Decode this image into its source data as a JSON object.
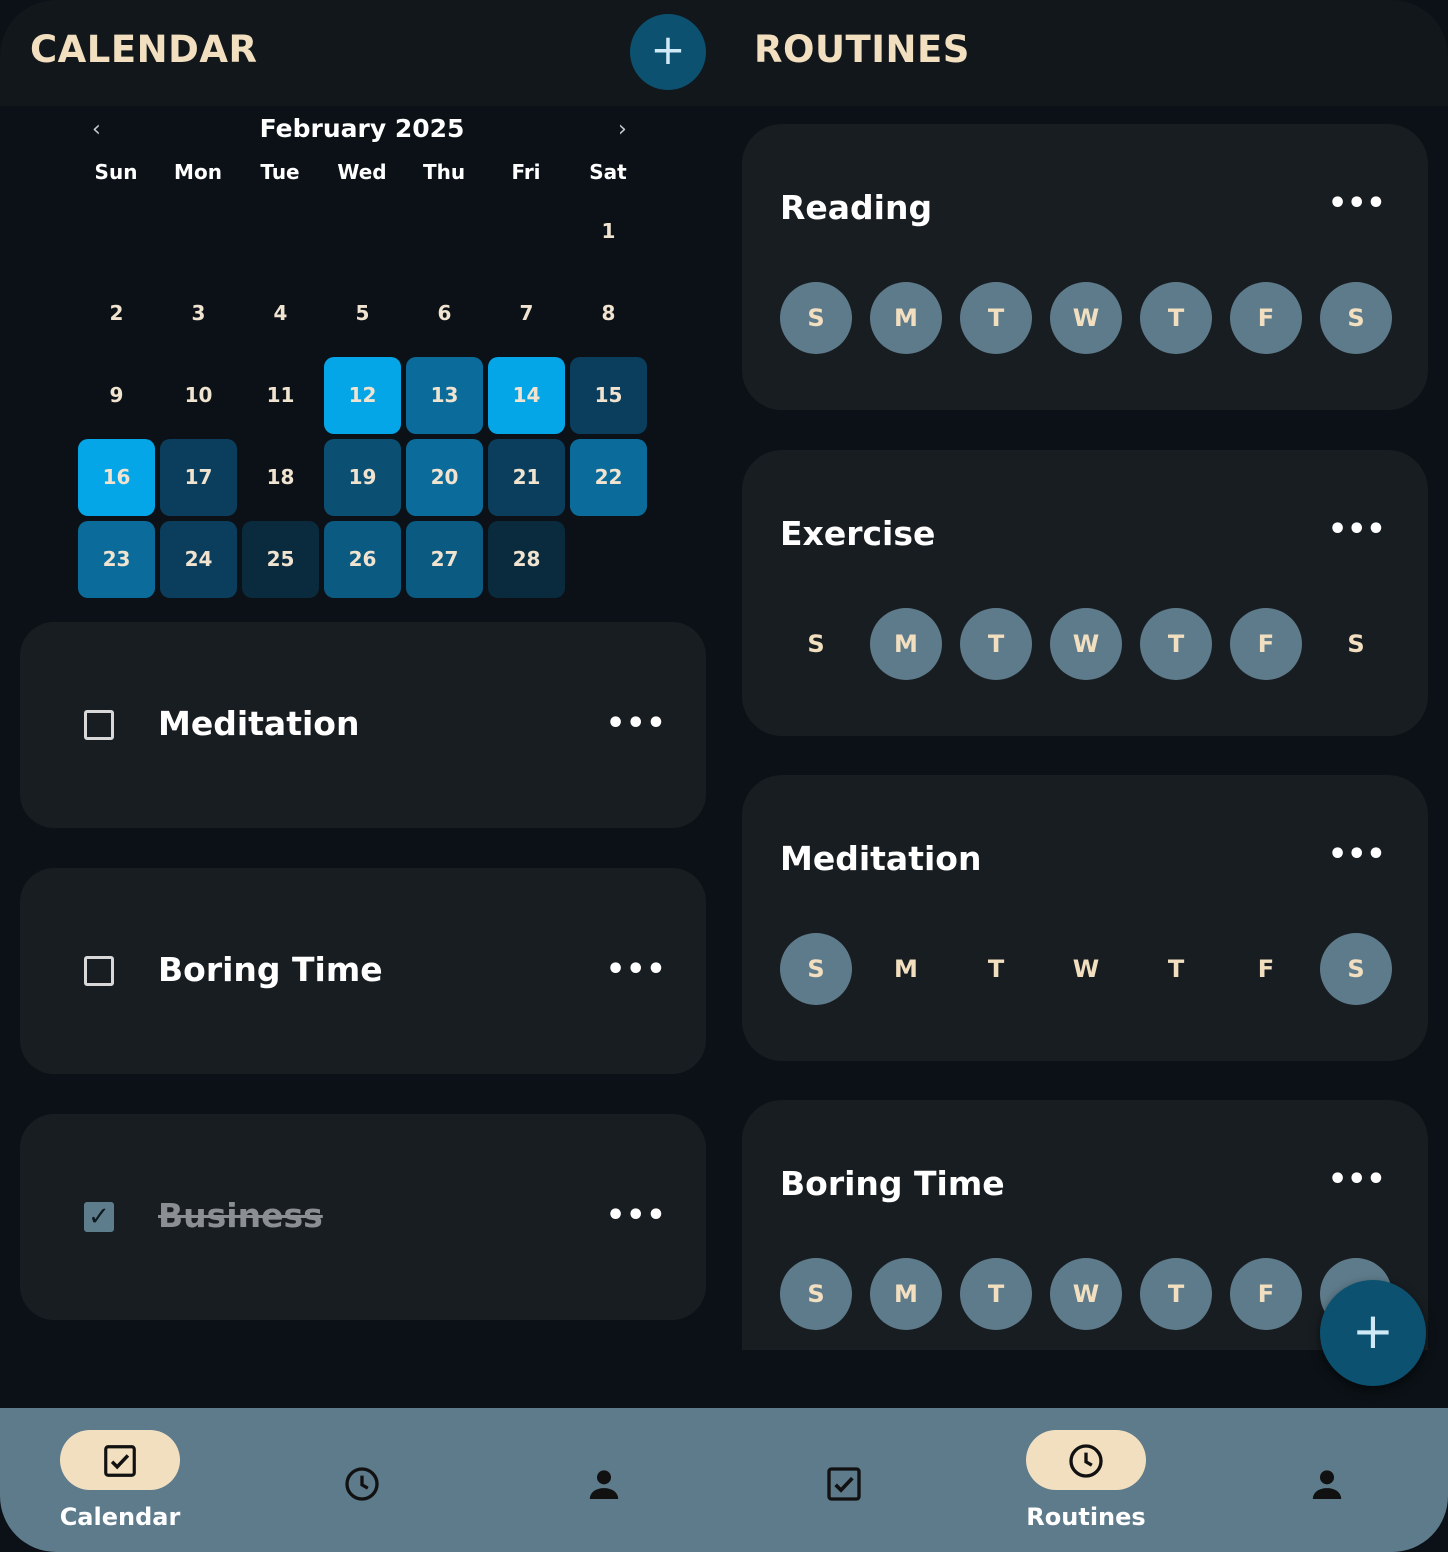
{
  "calendar_panel": {
    "title": "CALENDAR",
    "add_label": "+",
    "month": "February 2025",
    "prev": "‹",
    "next": "›",
    "weekdays": [
      "Sun",
      "Mon",
      "Tue",
      "Wed",
      "Thu",
      "Fri",
      "Sat"
    ],
    "days": [
      {
        "n": "1",
        "c": "none",
        "col": 6,
        "row": 0
      },
      {
        "n": "2",
        "c": "none",
        "col": 0,
        "row": 1
      },
      {
        "n": "3",
        "c": "none",
        "col": 1,
        "row": 1
      },
      {
        "n": "4",
        "c": "none",
        "col": 2,
        "row": 1
      },
      {
        "n": "5",
        "c": "none",
        "col": 3,
        "row": 1
      },
      {
        "n": "6",
        "c": "none",
        "col": 4,
        "row": 1
      },
      {
        "n": "7",
        "c": "none",
        "col": 5,
        "row": 1
      },
      {
        "n": "8",
        "c": "none",
        "col": 6,
        "row": 1
      },
      {
        "n": "9",
        "c": "none",
        "col": 0,
        "row": 2
      },
      {
        "n": "10",
        "c": "none",
        "col": 1,
        "row": 2
      },
      {
        "n": "11",
        "c": "none",
        "col": 2,
        "row": 2
      },
      {
        "n": "12",
        "c": "#04a6e8",
        "col": 3,
        "row": 2
      },
      {
        "n": "13",
        "c": "#0b6c9c",
        "col": 4,
        "row": 2
      },
      {
        "n": "14",
        "c": "#04a6e8",
        "col": 5,
        "row": 2
      },
      {
        "n": "15",
        "c": "#0b3e5c",
        "col": 6,
        "row": 2
      },
      {
        "n": "16",
        "c": "#04a6e8",
        "col": 0,
        "row": 3
      },
      {
        "n": "17",
        "c": "#0b3e5c",
        "col": 1,
        "row": 3
      },
      {
        "n": "18",
        "c": "none",
        "col": 2,
        "row": 3
      },
      {
        "n": "19",
        "c": "#0b4f72",
        "col": 3,
        "row": 3
      },
      {
        "n": "20",
        "c": "#0b6c9c",
        "col": 4,
        "row": 3
      },
      {
        "n": "21",
        "c": "#0b3e5c",
        "col": 5,
        "row": 3
      },
      {
        "n": "22",
        "c": "#0b6c9c",
        "col": 6,
        "row": 3
      },
      {
        "n": "23",
        "c": "#0b6c9c",
        "col": 0,
        "row": 4
      },
      {
        "n": "24",
        "c": "#0b3e5c",
        "col": 1,
        "row": 4
      },
      {
        "n": "25",
        "c": "#0a2a3d",
        "col": 2,
        "row": 4
      },
      {
        "n": "26",
        "c": "#0b5a82",
        "col": 3,
        "row": 4
      },
      {
        "n": "27",
        "c": "#0b5a82",
        "col": 4,
        "row": 4
      },
      {
        "n": "28",
        "c": "#0a2a3d",
        "col": 5,
        "row": 4
      }
    ]
  },
  "tasks": [
    {
      "label": "Meditation",
      "checked": false,
      "menu": "•••"
    },
    {
      "label": "Boring Time",
      "checked": false,
      "menu": "•••"
    },
    {
      "label": "Business",
      "checked": true,
      "menu": "•••"
    }
  ],
  "routines_panel": {
    "title": "ROUTINES",
    "fab_label": "+",
    "routines": [
      {
        "name": "Reading",
        "menu": "•••",
        "days": [
          {
            "l": "S",
            "on": true
          },
          {
            "l": "M",
            "on": true
          },
          {
            "l": "T",
            "on": true
          },
          {
            "l": "W",
            "on": true
          },
          {
            "l": "T",
            "on": true
          },
          {
            "l": "F",
            "on": true
          },
          {
            "l": "S",
            "on": true
          }
        ]
      },
      {
        "name": "Exercise",
        "menu": "•••",
        "days": [
          {
            "l": "S",
            "on": false
          },
          {
            "l": "M",
            "on": true
          },
          {
            "l": "T",
            "on": true
          },
          {
            "l": "W",
            "on": true
          },
          {
            "l": "T",
            "on": true
          },
          {
            "l": "F",
            "on": true
          },
          {
            "l": "S",
            "on": false
          }
        ]
      },
      {
        "name": "Meditation",
        "menu": "•••",
        "days": [
          {
            "l": "S",
            "on": true
          },
          {
            "l": "M",
            "on": false
          },
          {
            "l": "T",
            "on": false
          },
          {
            "l": "W",
            "on": false
          },
          {
            "l": "T",
            "on": false
          },
          {
            "l": "F",
            "on": false
          },
          {
            "l": "S",
            "on": true
          }
        ]
      },
      {
        "name": "Boring Time",
        "menu": "•••",
        "days": [
          {
            "l": "S",
            "on": true
          },
          {
            "l": "M",
            "on": true
          },
          {
            "l": "T",
            "on": true
          },
          {
            "l": "W",
            "on": true
          },
          {
            "l": "T",
            "on": true
          },
          {
            "l": "F",
            "on": true
          },
          {
            "l": "S",
            "on": true
          }
        ]
      }
    ]
  },
  "bottom_nav": {
    "left_active_label": "Calendar",
    "right_active_label": "Routines",
    "icons": [
      "checkbox-icon",
      "clock-icon",
      "person-icon",
      "checkbox-icon",
      "clock-icon",
      "person-icon"
    ]
  },
  "colors": {
    "accent": "#04a6e8",
    "cream": "#f2dfc0",
    "nav": "#5e7b8b",
    "fab": "#0c5170"
  }
}
